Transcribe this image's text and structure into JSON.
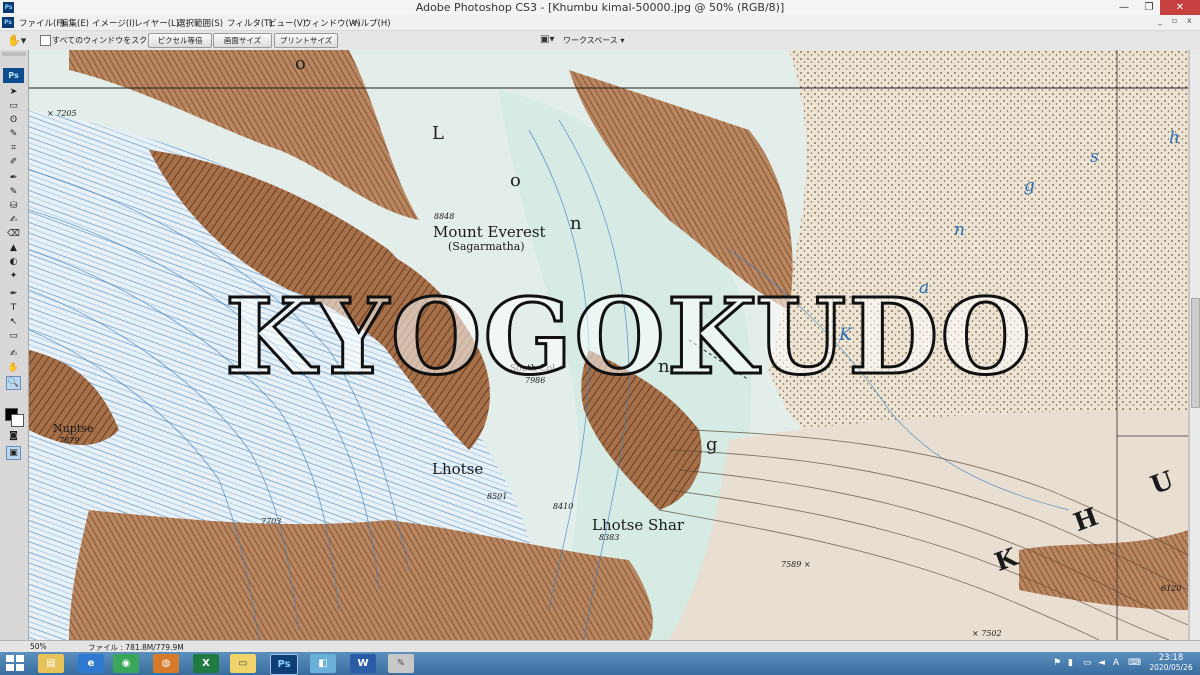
{
  "app": {
    "title": "Adobe Photoshop CS3 - [Khumbu kimal-50000.jpg @ 50% (RGB/8)]",
    "icon_text": "Ps"
  },
  "window_controls": {
    "minimize": "—",
    "restore": "❐",
    "close": "✕"
  },
  "menu": {
    "items": [
      "ファイル(F)",
      "編集(E)",
      "イメージ(I)",
      "レイヤー(L)",
      "選択範囲(S)",
      "フィルタ(T)",
      "ビュー(V)",
      "ウィンドウ(W)",
      "ヘルプ(H)"
    ],
    "doc_controls": {
      "minimize": "_",
      "restore": "▫",
      "close": "x"
    }
  },
  "options_bar": {
    "scroll_all_label": "すべてのウィンドウをスクロール",
    "buttons": [
      "ピクセル等倍",
      "画面サイズ",
      "プリントサイズ"
    ],
    "workspace_label": "ワークスペース ▾"
  },
  "toolbox": {
    "logo": "Ps",
    "tools": [
      "➤",
      "▭",
      "ʘ",
      "✎",
      "⌗",
      "✐",
      "✒",
      "✎",
      "⛁",
      "✍",
      "⌫",
      "▲",
      "◐",
      "✦",
      "✒",
      "T",
      "↖",
      "▭",
      "✍",
      "✋",
      "🔍"
    ]
  },
  "map": {
    "labels": {
      "everest": "Mount Everest",
      "sagarmatha": "(Sagarmatha)",
      "everest_height": "8848",
      "south_col": "South Col",
      "south_col_height": "7986",
      "lhotse": "Lhotse",
      "lhotse_height": "8501",
      "lhotse_peak": "8410",
      "lhotse_shar": "Lhotse Shar",
      "lhotse_shar_height": "8383",
      "nuptse": "Nuptse",
      "nuptse_height": "7879",
      "h7205": "× 7205",
      "h7589": "7589 ×",
      "h7502": "× 7502",
      "h7703": "7703",
      "h6120": "6120",
      "kh_k": "K",
      "kh_h": "H",
      "kh_u": "U",
      "kangshung": [
        "K",
        "a",
        "n",
        "g",
        "s",
        "h"
      ],
      "lo_la": [
        "o",
        "L",
        "o",
        "n"
      ],
      "n_letter": "n",
      "g_letter": "g"
    },
    "watermark": "KYOGOKUDO"
  },
  "status": {
    "zoom": "50%",
    "file_info": "ファイル : 781.8M/779.9M"
  },
  "taskbar": {
    "word_letter": "W",
    "excel_letter": "X",
    "ps_letter": "Ps",
    "clock_time": "23:18",
    "clock_date": "2020/05/26"
  }
}
